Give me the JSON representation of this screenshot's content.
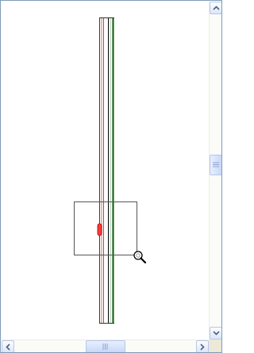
{
  "viewer": {
    "icons": {
      "zoom_cursor": "magnifier-icon",
      "scroll_up": "arrow-up-icon",
      "scroll_down": "arrow-down-icon",
      "scroll_left": "arrow-left-icon",
      "scroll_right": "arrow-right-icon",
      "grip": "grip-icon"
    },
    "colors": {
      "outer_border": "#7f9db9",
      "track_line_red": "#b04a4a",
      "track_line_pink": "#e8b8b8",
      "track_line_green": "#0a5a0a",
      "track_line_black": "#000000",
      "marker_fill": "#ff3b3b",
      "selection_box": "#555555"
    }
  },
  "scroll": {
    "vertical_position": 0.48,
    "horizontal_position": 0.5
  }
}
